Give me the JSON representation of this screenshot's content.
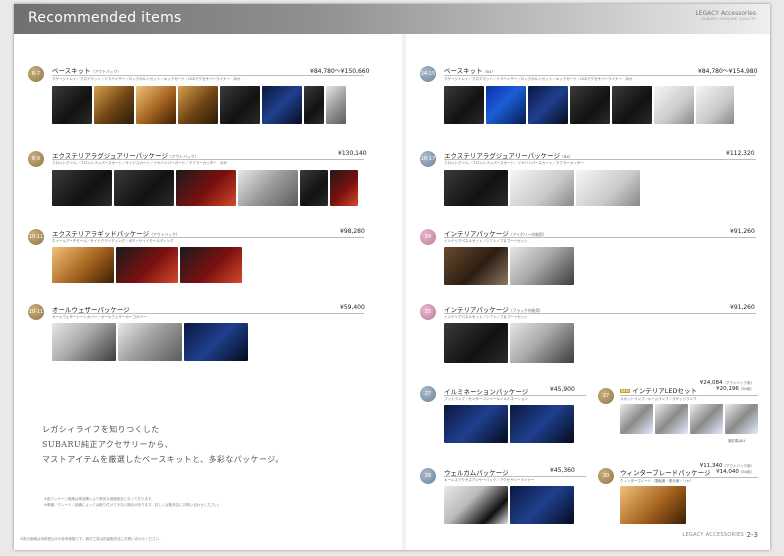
{
  "header": {
    "title": "Recommended items",
    "brand_line1": "LEGACY Accessories",
    "brand_line2": "SUBARU GENUINE QUALITY"
  },
  "left": {
    "items": [
      {
        "badge": "6-7",
        "title": "ベースキット",
        "sub": "（アウトバック）",
        "price": "¥84,780〜¥150,660",
        "desc": "ラゲージトレイ／フロアマット／ドアバイザー／ロックボルトセット／キックガード／LEDアクセサリーライナー　ほか"
      },
      {
        "badge": "8-9",
        "title": "エクステリアラグジュアリーパッケージ",
        "sub": "（アウトバック）",
        "price": "¥130,140",
        "desc": "フロントグリル／フロントバンパースカート／サイドスカート／リヤバンパーガード／マフラーカッター　ほか"
      },
      {
        "badge": "10-11",
        "title": "エクステリアラギッドパッケージ",
        "sub": "（アウトバック）",
        "price": "¥98,280",
        "desc": "ホイールアーチモール／サイドクラッディング／ボディサイドモールディング"
      },
      {
        "badge": "10-11",
        "title": "オールウェザーパッケージ",
        "sub": "",
        "price": "¥59,400",
        "desc": "オールウェザーシートカバー／オールウェザーカーゴカバー"
      }
    ],
    "intro_lines": [
      "レガシィライフを知りつくした",
      "SUBARU純正アクセサリーから、",
      "マストアイテムを厳選したベースキットと、多彩なパッケージ。"
    ],
    "note_lines": [
      "※各パッケージ価格は単品購入より割安な価格設定となっております。",
      "※車種／グレード／装備によっては取り付けできない場合があります。詳しくは販売店にお問い合わせください。"
    ],
    "footnote": "※表示価格は消費税込みの参考価格です。取付工賃は別途販売店にお問い合わせください。"
  },
  "right": {
    "items": [
      {
        "badge": "14-15",
        "title": "ベースキット",
        "sub": "（B4）",
        "price": "¥84,780〜¥154,980",
        "desc": "ラゲージトレイ／フロアマット／ドアバイザー／ロックボルトセット／キックガード／LEDアクセサリーライナー　ほか"
      },
      {
        "badge": "16-17",
        "title": "エクステリアラグジュアリーパッケージ",
        "sub": "（B4）",
        "price": "¥112,320",
        "desc": "フロントグリル／フロントバンパースカート／リヤバンパースカート／マフラーカッター"
      },
      {
        "badge": "24",
        "title": "インテリアパッケージ",
        "sub": "（アイボリー内装用）",
        "price": "¥91,260",
        "desc": "インテリアパネルセット／シフトノブ＆ブーツセット"
      },
      {
        "badge": "25",
        "title": "インテリアパッケージ",
        "sub": "（ブラック内装用）",
        "price": "¥91,260",
        "desc": "インテリアパネルセット／シフトノブ＆ブーツセット"
      },
      {
        "badge": "27",
        "title": "イルミネーションパッケージ",
        "sub": "",
        "price": "¥45,900",
        "desc": "フットランプ／センターコンソールイルミネーション"
      },
      {
        "badge": "28",
        "title": "ウェルカムパッケージ",
        "sub": "",
        "price": "¥45,360",
        "desc": "キーレスアクセスアンサーバック／アクセサリーライナー"
      }
    ],
    "small_items": [
      {
        "badge": "27",
        "tag": "NEW",
        "title": "インテリアLEDセット",
        "price_a": "¥24,084",
        "price_a_note": "（アウトバック用）",
        "price_b": "¥20,196",
        "price_b_note": "（B4用）",
        "desc": "スポットランプ／ルームランプ／ラゲッジランプ",
        "caption": "撮影車はB4"
      },
      {
        "badge": "30",
        "tag": "",
        "title": "ウィンターブレードパッケージ",
        "price_a": "¥11,340",
        "price_a_note": "（アウトバック用）",
        "price_b": "¥14,040",
        "price_b_note": "（B4用）",
        "desc": "ウィンターブレード（運転席／助手席／リヤ）",
        "caption": ""
      }
    ],
    "footer_brand": "LEGACY ACCESSORIES",
    "page_number": "2-3"
  },
  "colors": {
    "badge_gold": "#a48b5d",
    "badge_blue": "#8298ac",
    "badge_pink": "#d29ab7",
    "banner": "#8a8a8a"
  }
}
